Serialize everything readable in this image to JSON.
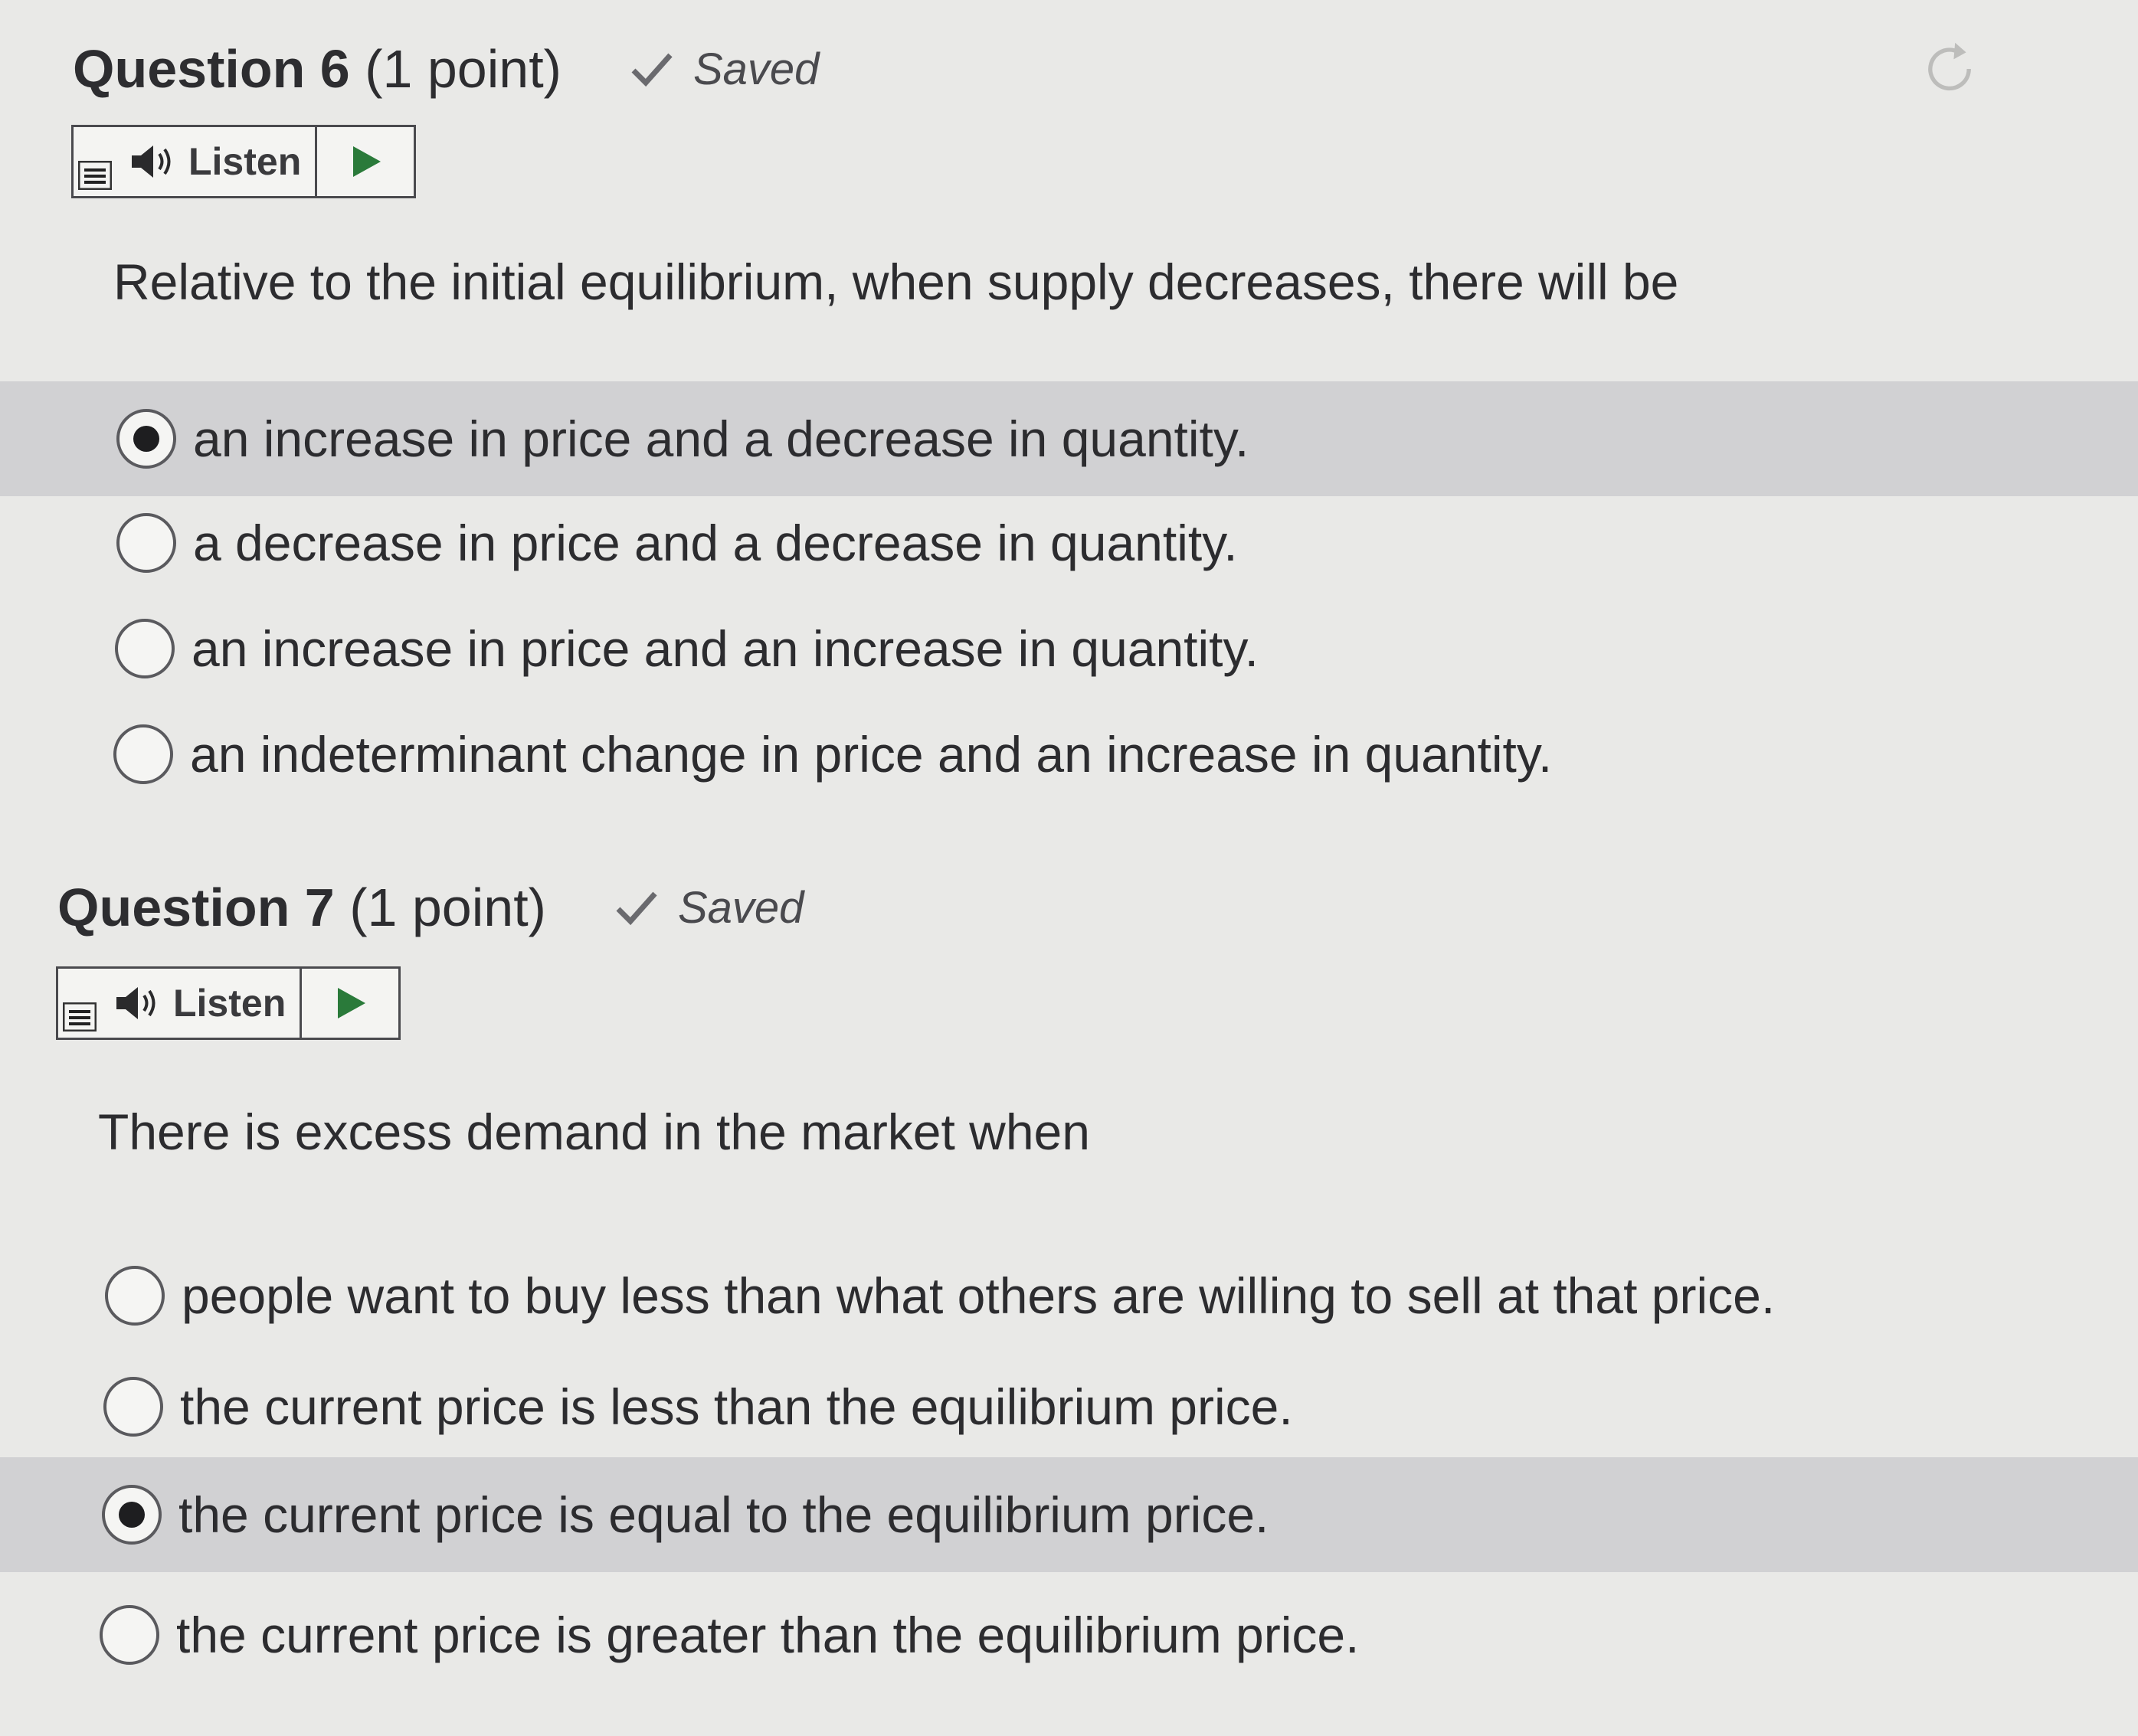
{
  "questions": [
    {
      "number_label": "Question 6",
      "points_label": "(1 point)",
      "saved_label": "Saved",
      "listen_label": "Listen",
      "prompt": "Relative to the initial equilibrium, when supply decreases, there will be",
      "options": [
        {
          "label": "an increase in price and a decrease in quantity.",
          "selected": true
        },
        {
          "label": "a decrease in price and a decrease in quantity.",
          "selected": false
        },
        {
          "label": "an increase in price and an increase in quantity.",
          "selected": false
        },
        {
          "label": "an indeterminant change in price and an increase in quantity.",
          "selected": false
        }
      ]
    },
    {
      "number_label": "Question 7",
      "points_label": "(1 point)",
      "saved_label": "Saved",
      "listen_label": "Listen",
      "prompt": "There is excess demand in the market when",
      "options": [
        {
          "label": "people want to buy less than what others are willing to sell at that price.",
          "selected": false
        },
        {
          "label": "the current price is less than the equilibrium price.",
          "selected": false
        },
        {
          "label": "the current price is equal to the equilibrium price.",
          "selected": true
        },
        {
          "label": "the current price is greater than the equilibrium price.",
          "selected": false
        }
      ]
    }
  ],
  "icons": {
    "saved": "checkmark-icon",
    "listen": "speaker-icon",
    "play": "play-icon",
    "menu": "menu-icon",
    "reload": "reload-icon"
  },
  "colors": {
    "background": "#e9e9e7",
    "selected_row": "#c6c6c9",
    "text": "#2c2c2f",
    "radio_dot": "#1e1e20"
  }
}
